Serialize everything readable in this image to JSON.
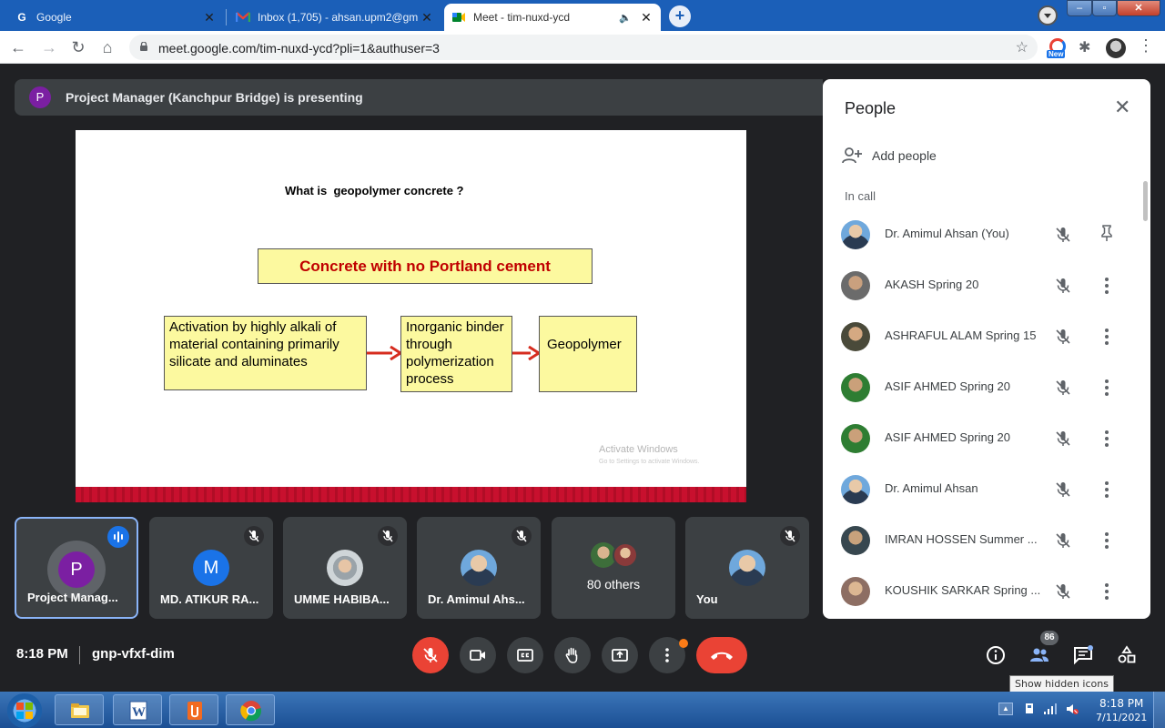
{
  "browser": {
    "tabs": [
      {
        "title": "Google",
        "icon": "google-icon",
        "active": false
      },
      {
        "title": "Inbox (1,705) - ahsan.upm2@gm",
        "icon": "gmail-icon",
        "active": false
      },
      {
        "title": "Meet - tim-nuxd-ycd",
        "icon": "meet-icon",
        "active": true
      }
    ],
    "url": "meet.google.com/tim-nuxd-ycd?pli=1&authuser=3",
    "extension_badge": "New"
  },
  "meet": {
    "presenter_initial": "P",
    "presenting_text": "Project Manager (Kanchpur Bridge) is presenting",
    "slide": {
      "title": "What is  geopolymer concrete ?",
      "banner": "Concrete with no Portland cement",
      "boxes": [
        "Activation by highly alkali of material containing primarily silicate and aluminates",
        "Inorganic binder through polymerization process",
        "Geopolymer"
      ],
      "watermark_title": "Activate Windows",
      "watermark_sub": "Go to Settings to activate Windows."
    },
    "tiles": [
      {
        "name": "Project Manag...",
        "initial": "P",
        "color": "#7b1fa2",
        "state": "speaking"
      },
      {
        "name": "MD. ATIKUR RA...",
        "initial": "M",
        "color": "#1a73e8",
        "state": "muted"
      },
      {
        "name": "UMME HABIBA...",
        "state": "muted"
      },
      {
        "name": "Dr. Amimul Ahs...",
        "state": "muted"
      },
      {
        "name": "80 others"
      },
      {
        "name": "You",
        "state": "muted"
      }
    ],
    "people": {
      "title": "People",
      "add_label": "Add people",
      "section": "In call",
      "list": [
        {
          "name": "Dr. Amimul Ahsan (You)",
          "action": "pin-icon"
        },
        {
          "name": "AKASH Spring 20",
          "action": "more-icon"
        },
        {
          "name": "ASHRAFUL ALAM Spring 15",
          "action": "more-icon"
        },
        {
          "name": "ASIF AHMED Spring 20",
          "action": "more-icon"
        },
        {
          "name": "ASIF AHMED Spring 20",
          "action": "more-icon"
        },
        {
          "name": "Dr. Amimul Ahsan",
          "action": "more-icon"
        },
        {
          "name": "IMRAN HOSSEN Summer ...",
          "action": "more-icon"
        },
        {
          "name": "KOUSHIK SARKAR Spring ...",
          "action": "more-icon"
        }
      ]
    },
    "controls": {
      "time": "8:18 PM",
      "meeting_code": "gnp-vfxf-dim",
      "people_count": "86",
      "tooltip": "Show hidden icons"
    }
  },
  "taskbar": {
    "time": "8:18 PM",
    "date": "7/11/2021"
  },
  "colors": {
    "meet_red": "#ea4335",
    "tile_bg": "#3c4043",
    "slide_banner_text": "#c00000",
    "slide_box_fill": "#fcf99f"
  }
}
